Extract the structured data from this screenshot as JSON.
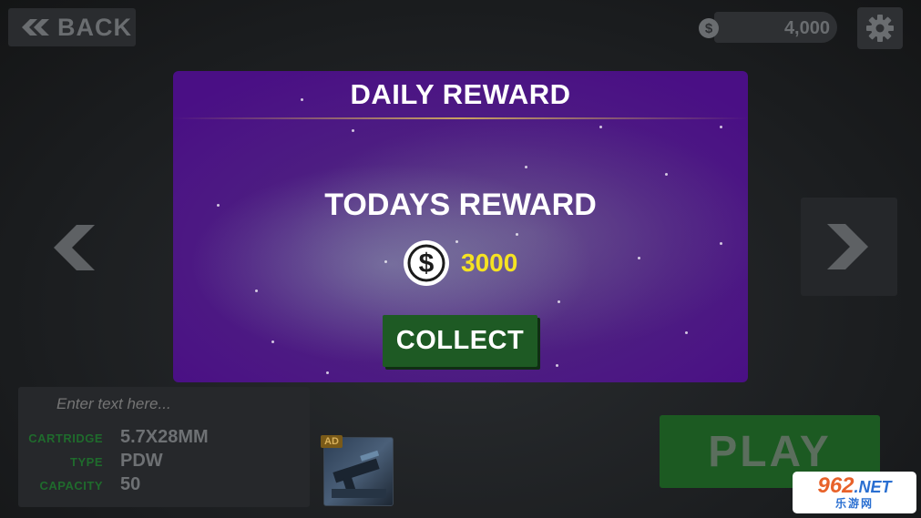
{
  "topbar": {
    "back_label": "BACK",
    "coins": "4,000"
  },
  "modal": {
    "title": "DAILY REWARD",
    "heading": "TODAYS REWARD",
    "amount": "3000",
    "collect_label": "COLLECT"
  },
  "info_panel": {
    "placeholder": "Enter text here...",
    "rows": [
      {
        "key": "CARTRIDGE",
        "value": "5.7X28MM"
      },
      {
        "key": "TYPE",
        "value": "PDW"
      },
      {
        "key": "CAPACITY",
        "value": "50"
      }
    ]
  },
  "ad": {
    "badge": "AD"
  },
  "play_label": "PLAY",
  "watermark": {
    "top": "962",
    "net": ".NET",
    "bottom": "乐游网"
  },
  "colors": {
    "modal_purple": "#4a0f85",
    "reward_yellow": "#f5e322",
    "button_green": "#1e5a24",
    "label_green": "#1f6b2c"
  },
  "icons": [
    "double-chevron-left-icon",
    "dollar-coin-icon",
    "gear-icon",
    "chevron-left-icon",
    "chevron-right-icon"
  ]
}
